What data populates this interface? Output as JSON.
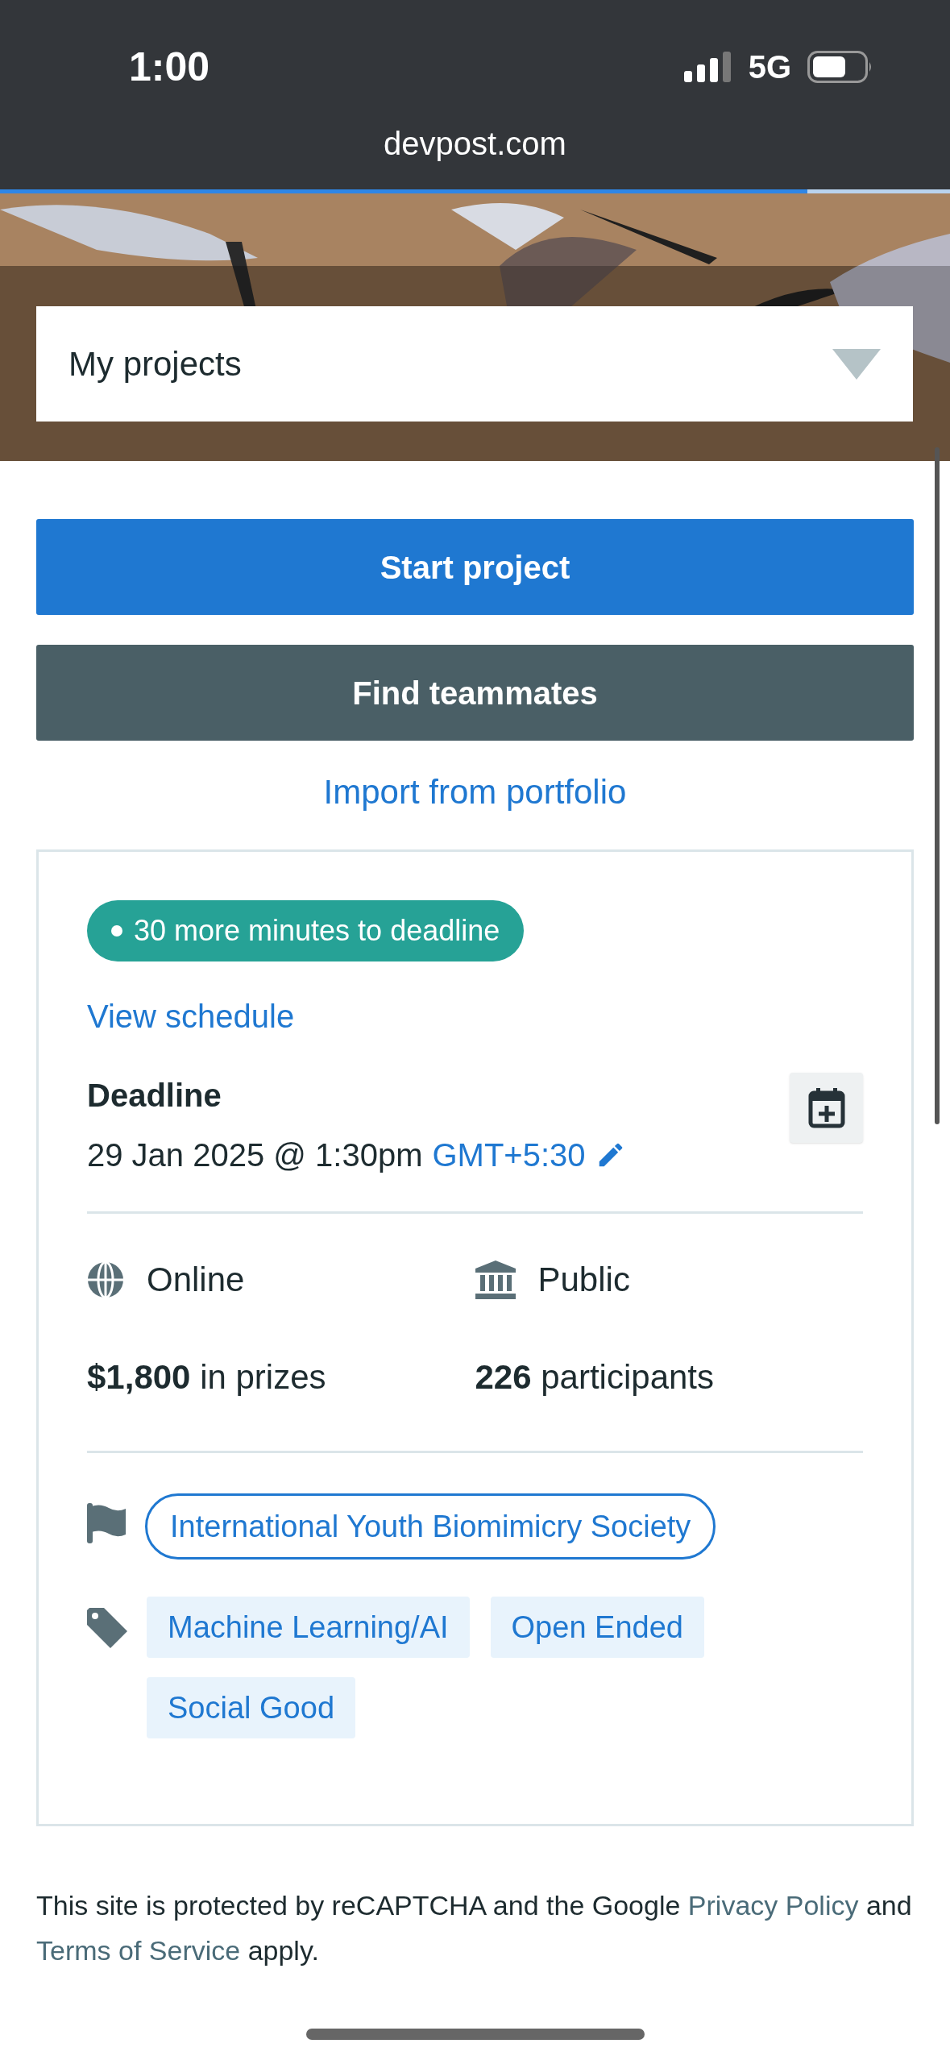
{
  "status_bar": {
    "time": "1:00",
    "network": "5G"
  },
  "browser": {
    "url": "devpost.com",
    "loading": {
      "level": 0.85
    }
  },
  "hero": {
    "kind": "picture",
    "dropdown": {
      "value": "My projects"
    }
  },
  "buttons": [
    {
      "label": "Start project",
      "kind": "primary"
    },
    {
      "label": "Find teammates",
      "kind": "secondary"
    }
  ],
  "import_link": "Import from portfolio",
  "card": {
    "badge": "30 more minutes to deadline",
    "schedule_link": "View schedule",
    "deadline_label": "Deadline",
    "deadline_date": "29 Jan 2025 @ 1:30pm",
    "timezone": "GMT+5:30",
    "facts": [
      {
        "kind": "online",
        "text": "Online"
      },
      {
        "kind": "public",
        "text": "Public"
      },
      {
        "kind": "stat",
        "text": "**$1,800** in prizes"
      },
      {
        "kind": "stat",
        "text": "**226** participants"
      }
    ],
    "host": "International Youth Biomimicry Society",
    "themes": [
      "Machine Learning/AI",
      "Open Ended",
      "Social Good"
    ]
  },
  "footer": {
    "parts": [
      {
        "kind": "text",
        "text": "This site is protected by reCAPTCHA and the Google"
      },
      {
        "kind": "link",
        "text": "Privacy Policy"
      },
      {
        "kind": "text",
        "text": "and"
      },
      {
        "kind": "link",
        "text": "Terms of Service"
      },
      {
        "kind": "text",
        "text": "apply."
      }
    ]
  }
}
